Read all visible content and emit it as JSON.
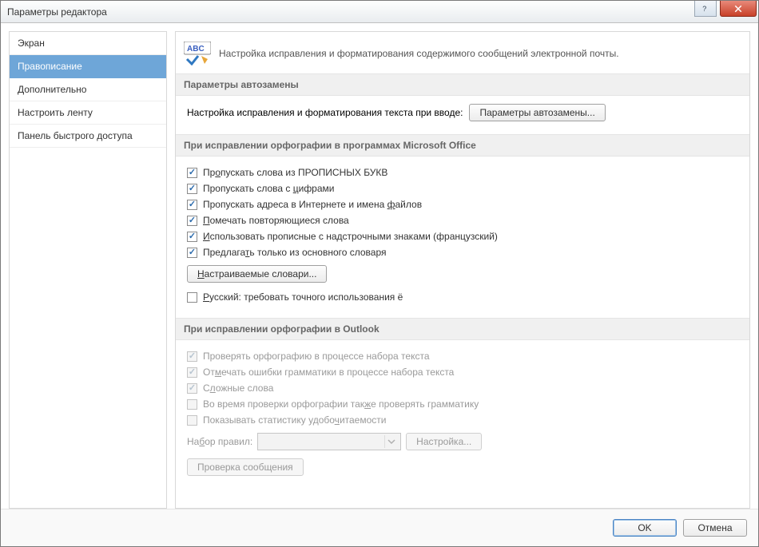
{
  "window": {
    "title": "Параметры редактора"
  },
  "sidebar": {
    "items": [
      {
        "label": "Экран"
      },
      {
        "label": "Правописание",
        "selected": true
      },
      {
        "label": "Дополнительно"
      },
      {
        "label": "Настроить ленту"
      },
      {
        "label": "Панель быстрого доступа"
      }
    ]
  },
  "header": {
    "description": "Настройка исправления и форматирования содержимого сообщений электронной почты."
  },
  "sections": {
    "autocorrect": {
      "title": "Параметры автозамены",
      "caption": "Настройка исправления и форматирования текста при вводе:",
      "button": "Параметры автозамены..."
    },
    "office_spell": {
      "title": "При исправлении орфографии в программах Microsoft Office",
      "items": [
        {
          "before": "Пр",
          "u": "о",
          "after": "пускать слова из ПРОПИСНЫХ БУКВ",
          "checked": true
        },
        {
          "before": "Пропускать слова с ",
          "u": "ц",
          "after": "ифрами",
          "checked": true
        },
        {
          "before": "Пропускать адреса в Интернете и имена ",
          "u": "ф",
          "after": "айлов",
          "checked": true
        },
        {
          "before": "",
          "u": "П",
          "after": "омечать повторяющиеся слова",
          "checked": true
        },
        {
          "before": "",
          "u": "И",
          "after": "спользовать прописные с надстрочными знаками (французский)",
          "checked": true
        },
        {
          "before": "Предлага",
          "u": "т",
          "after": "ь только из основного словаря",
          "checked": true
        }
      ],
      "dict_button": {
        "before": "",
        "u": "Н",
        "after": "астраиваемые словари..."
      },
      "extra": {
        "before": "",
        "u": "Р",
        "after": "усский: требовать точного использования ё",
        "checked": false
      }
    },
    "outlook_spell": {
      "title": "При исправлении орфографии в Outlook",
      "items": [
        {
          "before": "Проверять орфографию в процессе набора текста",
          "u": "",
          "after": "",
          "checked": true,
          "disabled": true
        },
        {
          "before": "От",
          "u": "м",
          "after": "ечать ошибки грамматики в процессе набора текста",
          "checked": true,
          "disabled": true
        },
        {
          "before": "С",
          "u": "л",
          "after": "ожные слова",
          "checked": true,
          "disabled": true
        },
        {
          "before": "Во время проверки орфографии так",
          "u": "ж",
          "after": "е проверять грамматику",
          "checked": false,
          "disabled": true
        },
        {
          "before": "Показывать статистику удобо",
          "u": "ч",
          "after": "итаемости",
          "checked": false,
          "disabled": true
        }
      ],
      "rules_label": {
        "before": "На",
        "u": "б",
        "after": "ор правил:"
      },
      "rules_settings_btn": "Настройка...",
      "check_msg_btn": "Проверка сообщения"
    }
  },
  "footer": {
    "ok": "OK",
    "cancel": "Отмена"
  }
}
